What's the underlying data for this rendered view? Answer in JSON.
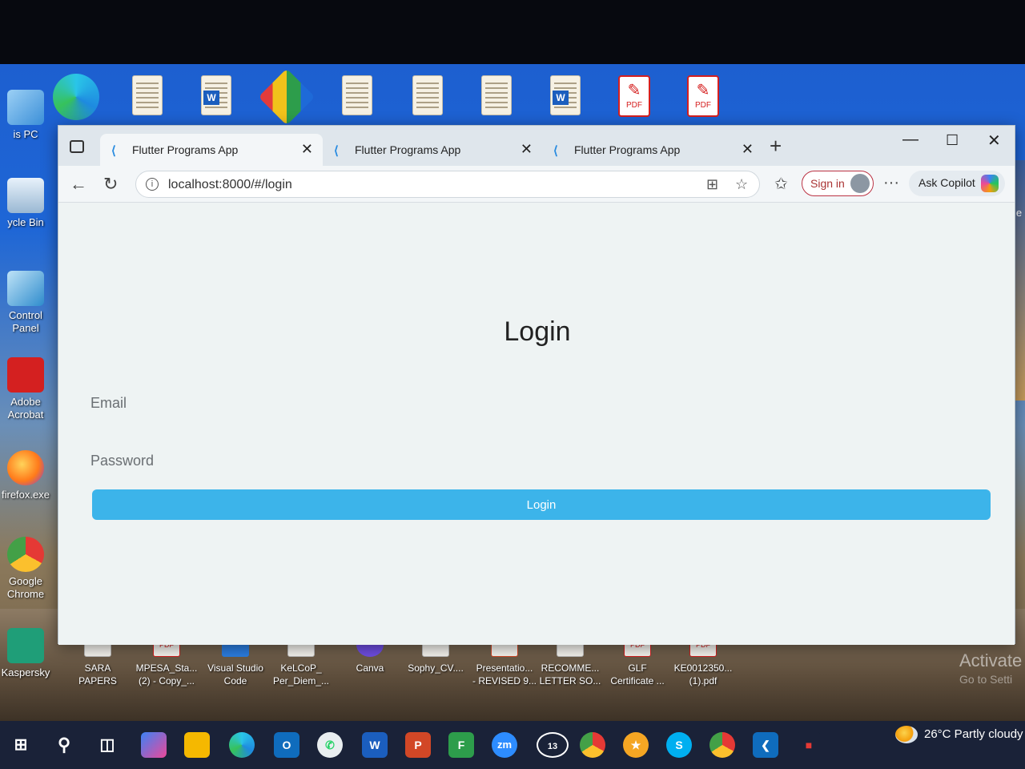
{
  "desktop": {
    "left_icons": [
      {
        "label": "is PC",
        "icon": "pc-icon"
      },
      {
        "label": "ycle Bin",
        "icon": "recycle-bin-icon"
      },
      {
        "label": "Control\nPanel",
        "icon": "control-panel-icon"
      },
      {
        "label": "Adobe\nAcrobat",
        "icon": "acrobat-icon"
      },
      {
        "label": "firefox.exe",
        "icon": "firefox-icon"
      },
      {
        "label": "Google\nChrome",
        "icon": "chrome-icon"
      },
      {
        "label": "Kaspersky",
        "icon": "kaspersky-icon"
      }
    ],
    "top_icons": [
      {
        "icon": "edge-icon"
      },
      {
        "icon": "document-icon"
      },
      {
        "icon": "word-icon"
      },
      {
        "icon": "app-icon"
      },
      {
        "icon": "document-icon"
      },
      {
        "icon": "document-icon"
      },
      {
        "icon": "document-icon"
      },
      {
        "icon": "word-icon"
      },
      {
        "icon": "pdf-icon",
        "badge": "PDF"
      },
      {
        "icon": "pdf-icon",
        "badge": "PDF"
      }
    ],
    "bottom_icons": [
      {
        "label": "SARA\nPAPERS"
      },
      {
        "label": "MPESA_Sta...\n(2) - Copy_...",
        "badge": "PDF"
      },
      {
        "label": "Visual Studio\nCode"
      },
      {
        "label": "KeLCoP_\nPer_Diem_..."
      },
      {
        "label": "Canva"
      },
      {
        "label": "Sophy_CV...."
      },
      {
        "label": "Presentatio...\n- REVISED 9..."
      },
      {
        "label": "RECOMME...\nLETTER SO..."
      },
      {
        "label": "GLF\nCertificate ...",
        "badge": "PDF"
      },
      {
        "label": "KE0012350...\n(1).pdf",
        "badge": "PDF"
      }
    ],
    "watermark": {
      "title": "Activate",
      "subtitle": "Go to Setti"
    },
    "edge_text": "le"
  },
  "browser": {
    "tabs": [
      {
        "title": "Flutter Programs App",
        "active": true
      },
      {
        "title": "Flutter Programs App",
        "active": false
      },
      {
        "title": "Flutter Programs App",
        "active": false
      }
    ],
    "new_tab": "+",
    "url": "localhost:8000/#/login",
    "sign_in": "Sign in",
    "copilot": "Ask Copilot",
    "more": "···"
  },
  "page": {
    "title": "Login",
    "email_placeholder": "Email",
    "password_placeholder": "Password",
    "login_button": "Login"
  },
  "taskbar": {
    "weather": "26°C  Partly cloudy",
    "whatsapp_badge": "13",
    "zoom_label": "zm"
  }
}
